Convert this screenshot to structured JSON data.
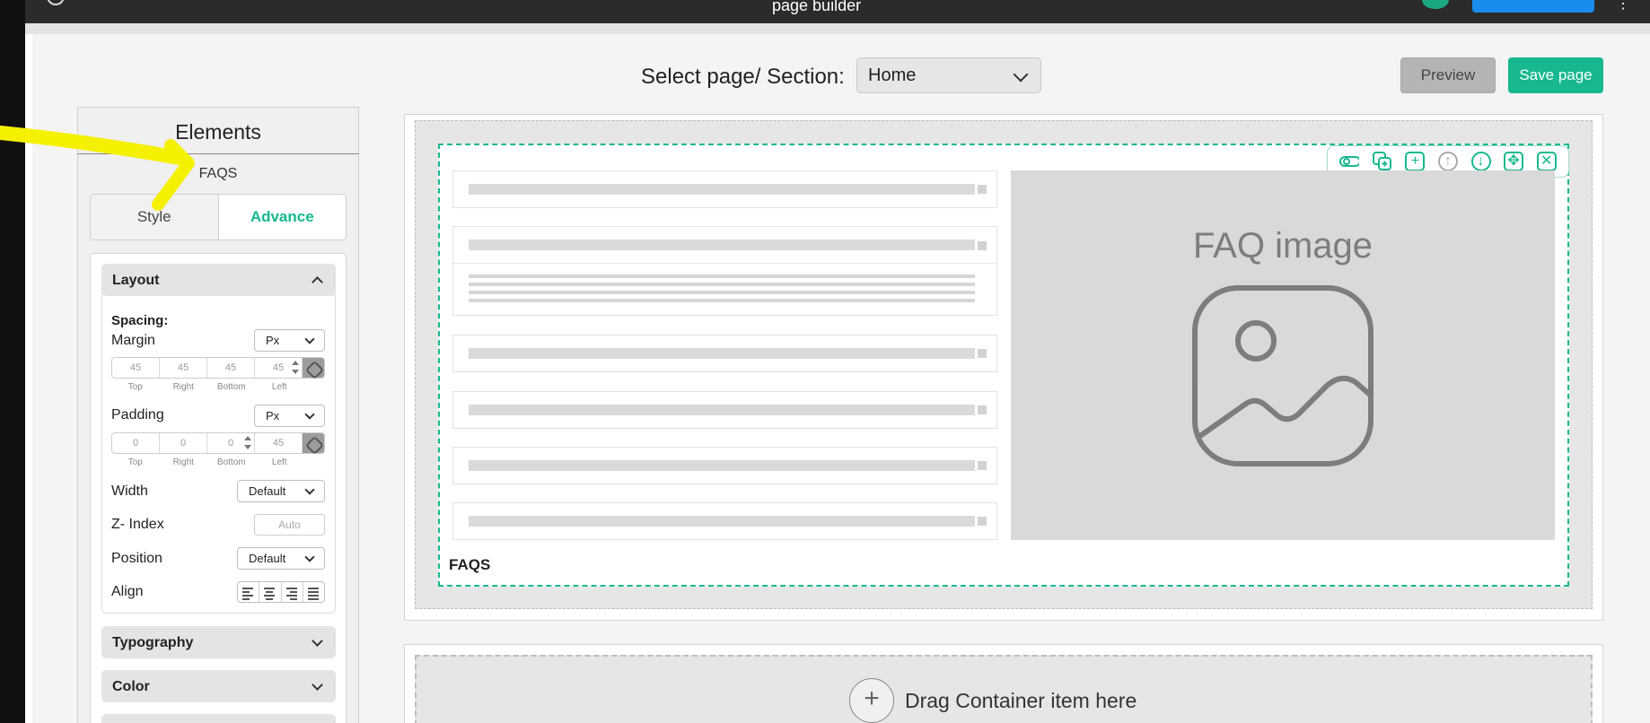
{
  "topbar": {
    "title": "page builder"
  },
  "header": {
    "select_label": "Select page/ Section:",
    "selected_page": "Home",
    "preview_label": "Preview",
    "save_label": "Save page"
  },
  "elements_panel": {
    "title": "Elements",
    "subtitle": "FAQS",
    "tabs": [
      "Style",
      "Advance"
    ],
    "active_tab": "Advance",
    "layout": {
      "heading": "Layout",
      "spacing_label": "Spacing:",
      "margin": {
        "label": "Margin",
        "unit": "Px",
        "values": [
          "45",
          "45",
          "45",
          "45"
        ],
        "sides": [
          "Top",
          "Right",
          "Bottom",
          "Left"
        ]
      },
      "padding": {
        "label": "Padding",
        "unit": "Px",
        "values": [
          "0",
          "0",
          "0",
          "45"
        ],
        "sides": [
          "Top",
          "Right",
          "Bottom",
          "Left"
        ]
      },
      "width": {
        "label": "Width",
        "value": "Default"
      },
      "zindex": {
        "label": "Z- Index",
        "placeholder": "Auto"
      },
      "position": {
        "label": "Position",
        "value": "Default"
      },
      "align": {
        "label": "Align"
      }
    },
    "sections": [
      "Typography",
      "Color"
    ]
  },
  "canvas": {
    "faq_image_label": "FAQ image",
    "faq_caption": "FAQS",
    "drop_zone_text": "Drag Container item here"
  },
  "colors": {
    "accent": "#17b890",
    "highlight": "#f5f000"
  }
}
